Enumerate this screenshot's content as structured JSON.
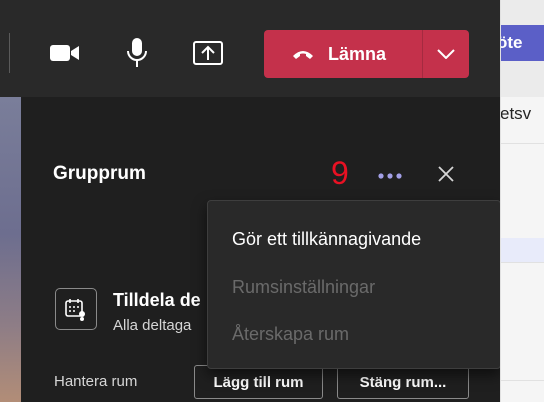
{
  "toolbar": {
    "icons": [
      "video-camera-icon",
      "microphone-icon",
      "share-screen-icon"
    ],
    "leave_label": "Lämna"
  },
  "panel": {
    "title": "Grupprum",
    "step_number": "9",
    "assign": {
      "title": "Tilldela de",
      "subtitle": "Alla deltaga"
    },
    "manage_label": "Hantera rum",
    "add_room_label": "Lägg till rum",
    "close_rooms_label": "Stäng rum..."
  },
  "menu": {
    "items": [
      {
        "label": "Gör ett tillkännagivande",
        "enabled": true
      },
      {
        "label": "Rumsinställningar",
        "enabled": false
      },
      {
        "label": "Återskapa rum",
        "enabled": false
      }
    ]
  },
  "right_app": {
    "meet_label": "öte",
    "fragment": "etsv"
  },
  "colors": {
    "leave_red": "#c4314b",
    "accent_purple": "#5b5fc7",
    "more_dots": "#a29fe6",
    "annotation_red": "#e81123"
  }
}
